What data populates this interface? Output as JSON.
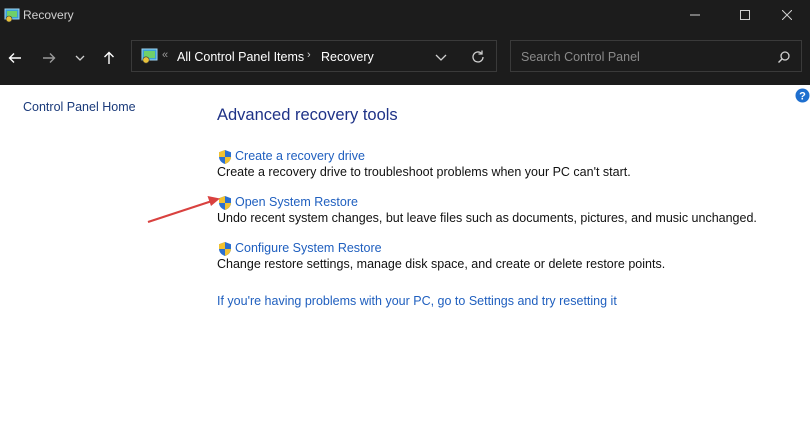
{
  "window": {
    "title": "Recovery"
  },
  "address": {
    "overflow": "«",
    "breadcrumbs": [
      "All Control Panel Items",
      "Recovery"
    ],
    "separator": "›"
  },
  "search": {
    "placeholder": "Search Control Panel"
  },
  "sidebar": {
    "home_link": "Control Panel Home"
  },
  "main": {
    "title": "Advanced recovery tools",
    "tasks": [
      {
        "label": "Create a recovery drive",
        "description": "Create a recovery drive to troubleshoot problems when your PC can't start."
      },
      {
        "label": "Open System Restore",
        "description": "Undo recent system changes, but leave files such as documents, pictures, and music unchanged."
      },
      {
        "label": "Configure System Restore",
        "description": "Change restore settings, manage disk space, and create or delete restore points."
      }
    ],
    "reset_link": "If you're having problems with your PC, go to Settings and try resetting it"
  },
  "icons": {
    "app": "control-panel-icon",
    "shield": "uac-shield-icon",
    "help": "help-icon"
  },
  "colors": {
    "chrome_bg": "#1c1c1c",
    "link": "#1f5fbf",
    "heading": "#1e3287",
    "annotation_arrow": "#d9413f"
  }
}
